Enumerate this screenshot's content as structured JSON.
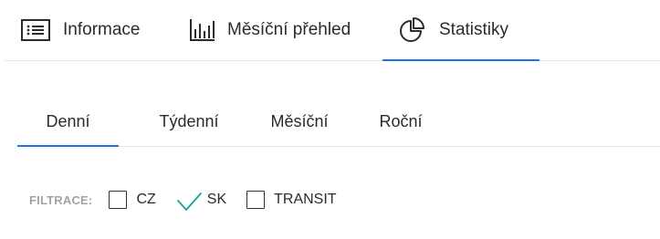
{
  "main_tabs": [
    {
      "label": "Informace",
      "icon": "list-icon"
    },
    {
      "label": "Měsíční přehled",
      "icon": "bar-chart-icon"
    },
    {
      "label": "Statistiky",
      "icon": "pie-chart-icon",
      "active": true
    }
  ],
  "sub_tabs": [
    {
      "label": "Denní",
      "active": true
    },
    {
      "label": "Týdenní"
    },
    {
      "label": "Měsíční"
    },
    {
      "label": "Roční"
    }
  ],
  "filter": {
    "label": "FILTRACE:",
    "options": [
      {
        "label": "CZ",
        "checked": false
      },
      {
        "label": "SK",
        "checked": true
      },
      {
        "label": "TRANSIT",
        "checked": false
      }
    ]
  },
  "colors": {
    "accent": "#1e73e8",
    "check": "#1aa39a",
    "muted": "#a3a3a3"
  }
}
